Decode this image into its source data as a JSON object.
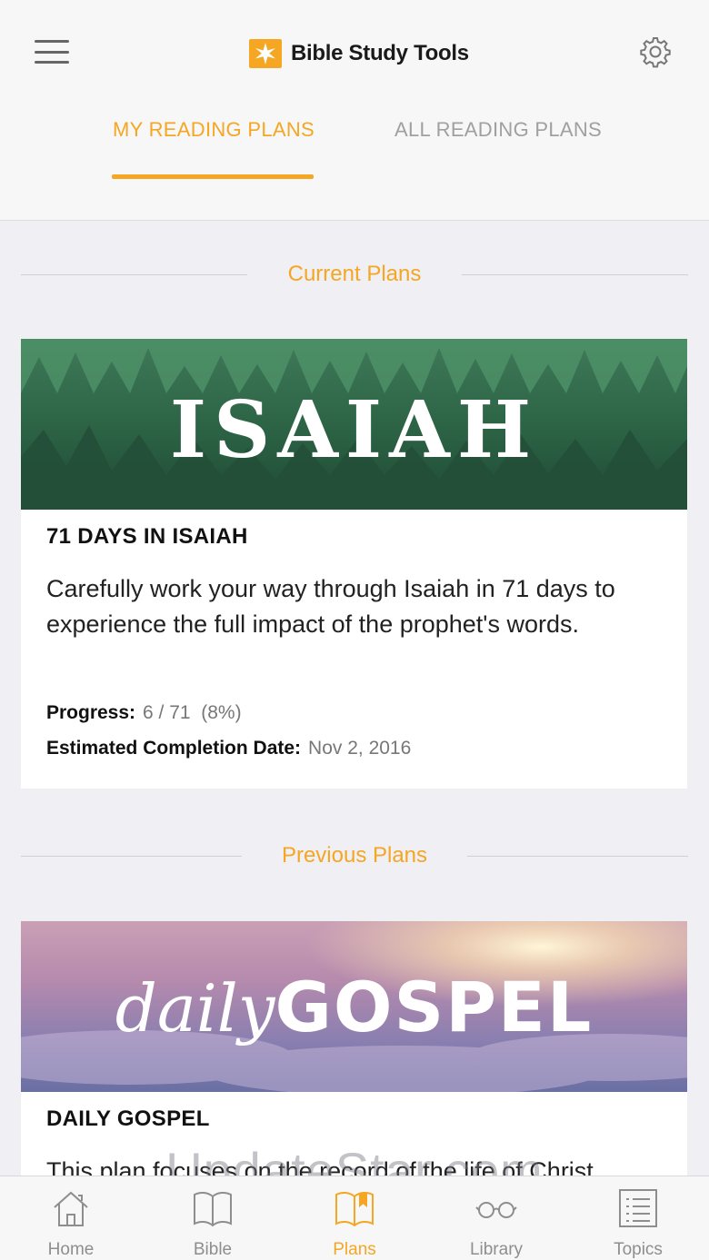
{
  "header": {
    "app_title": "Bible Study Tools",
    "menu_icon": "hamburger-menu-icon",
    "settings_icon": "gear-icon"
  },
  "tabs": [
    {
      "label": "MY READING PLANS",
      "active": true
    },
    {
      "label": "ALL READING PLANS",
      "active": false
    }
  ],
  "sections": {
    "current": "Current Plans",
    "previous": "Previous Plans"
  },
  "current_plan": {
    "banner_text": "ISAIAH",
    "title": "71 DAYS IN ISAIAH",
    "description": "Carefully work your way through Isaiah in 71 days to experience the full impact of the prophet's words.",
    "progress_label": "Progress:",
    "progress_value": "6 / 71  (8%)",
    "completion_label": "Estimated Completion Date:",
    "completion_value": "Nov 2, 2016"
  },
  "previous_plan": {
    "banner_text_script": "daily",
    "banner_text_bold": "GOSPEL",
    "title": "DAILY GOSPEL",
    "description": "This plan focuses on the record of the life of Christ."
  },
  "watermark": "UpdateStar.com",
  "bottom_nav": [
    {
      "label": "Home",
      "icon": "home-icon"
    },
    {
      "label": "Bible",
      "icon": "open-book-icon"
    },
    {
      "label": "Plans",
      "icon": "bookmarked-book-icon",
      "active": true
    },
    {
      "label": "Library",
      "icon": "glasses-icon"
    },
    {
      "label": "Topics",
      "icon": "list-icon"
    }
  ],
  "colors": {
    "accent": "#f5a623",
    "inactive_tab": "#a0a0a0",
    "background": "#efeff4"
  }
}
